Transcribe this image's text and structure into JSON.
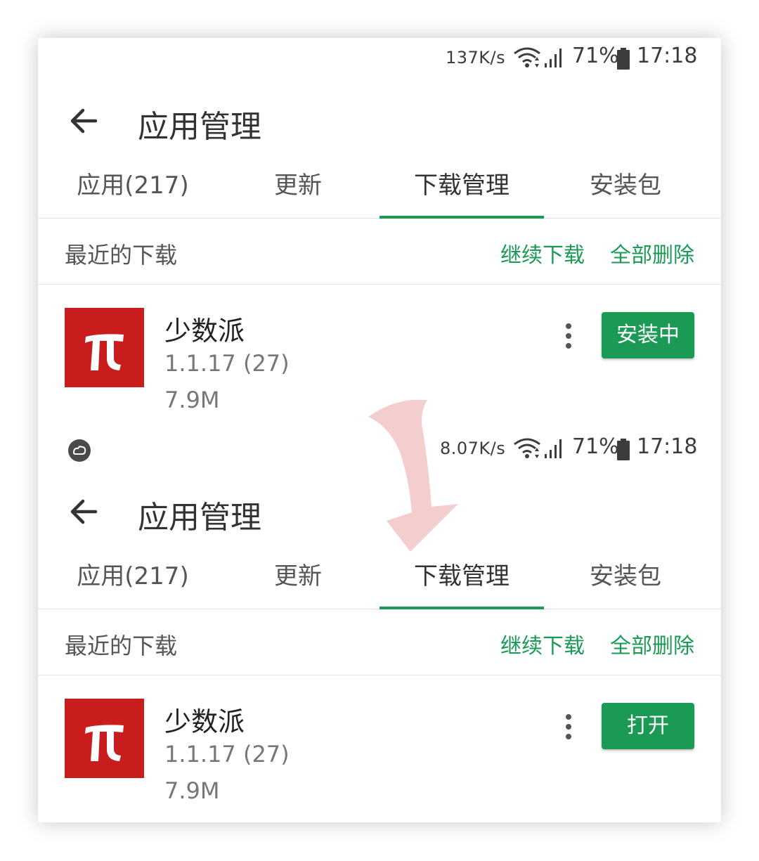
{
  "screens": [
    {
      "status": {
        "net_speed": "137K/s",
        "battery_pct": "71%",
        "time": "17:18",
        "show_cloud": false
      },
      "app_bar": {
        "title": "应用管理"
      },
      "tabs": [
        "应用(217)",
        "更新",
        "下载管理",
        "安装包"
      ],
      "active_tab": 2,
      "section": {
        "heading": "最近的下载",
        "resume_label": "继续下载",
        "delete_all_label": "全部删除"
      },
      "item": {
        "name": "少数派",
        "version": "1.1.17 (27)",
        "size": "7.9M",
        "button_label": "安装中"
      }
    },
    {
      "status": {
        "net_speed": "8.07K/s",
        "battery_pct": "71%",
        "time": "17:18",
        "show_cloud": true
      },
      "app_bar": {
        "title": "应用管理"
      },
      "tabs": [
        "应用(217)",
        "更新",
        "下载管理",
        "安装包"
      ],
      "active_tab": 2,
      "section": {
        "heading": "最近的下载",
        "resume_label": "继续下载",
        "delete_all_label": "全部删除"
      },
      "item": {
        "name": "少数派",
        "version": "1.1.17 (27)",
        "size": "7.9M",
        "button_label": "打开"
      }
    }
  ],
  "icons": {
    "back": "arrow-left-icon",
    "wifi": "wifi-icon",
    "signal": "signal-bars-icon",
    "battery": "battery-icon",
    "more": "more-vertical-icon",
    "cloud": "cloud-sync-icon",
    "app_logo": "pi-logo-icon",
    "transition": "curved-arrow-down-icon"
  },
  "colors": {
    "accent": "#1a9a55",
    "logo_red": "#c91c1c",
    "arrow_tint": "#f3c9c9",
    "text_primary": "#333333",
    "text_secondary": "#777777"
  }
}
